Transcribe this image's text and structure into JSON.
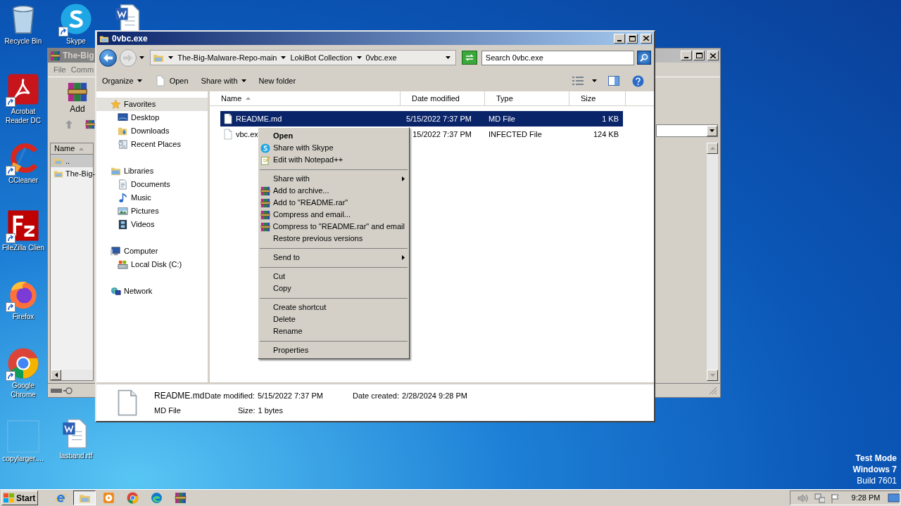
{
  "desktop_icons": [
    {
      "label": "Recycle Bin",
      "kind": "recycle",
      "shortcut": false
    },
    {
      "label": "Skype",
      "kind": "skype",
      "shortcut": true
    },
    {
      "kind": "word",
      "shortcut": false
    },
    {
      "label": "Acrobat Reader DC",
      "kind": "acrobat",
      "shortcut": true
    },
    {
      "label": "CCleaner",
      "kind": "ccleaner",
      "shortcut": true
    },
    {
      "label": "FileZilla Clien",
      "kind": "filezilla",
      "shortcut": true
    },
    {
      "label": "Firefox",
      "kind": "firefox",
      "shortcut": true
    },
    {
      "label": "Google Chrome",
      "kind": "chrome",
      "shortcut": true
    },
    {
      "label": "copylarger.…",
      "kind": "blank",
      "shortcut": false
    },
    {
      "label": "lasband.rtf",
      "kind": "word",
      "shortcut": false
    }
  ],
  "archiver_window": {
    "title": "The-Big",
    "menu": [
      "File",
      "Comm"
    ],
    "toolbar": [
      {
        "label": "Add"
      }
    ],
    "list_header": "Name",
    "rows": [
      {
        "name": "..",
        "selected": true
      },
      {
        "name": "The-Big-",
        "selected": false
      }
    ]
  },
  "explorer": {
    "title": "0vbc.exe",
    "breadcrumb": [
      "The-Big-Malware-Repo-main",
      "LokiBot Collection",
      "0vbc.exe"
    ],
    "search": {
      "placeholder": "Search 0vbc.exe"
    },
    "toolbar": [
      {
        "label": "Organize",
        "kind": "plain",
        "dropdown": true
      },
      {
        "label": "Open",
        "kind": "file",
        "dropdown": false
      },
      {
        "label": "Share with",
        "kind": "plain",
        "dropdown": true
      },
      {
        "label": "New folder",
        "kind": "plain",
        "dropdown": false
      }
    ],
    "nav": [
      {
        "label": "Favorites",
        "kind": "star",
        "selected": true,
        "children": [
          {
            "label": "Desktop",
            "kind": "desktop",
            "selected": false
          },
          {
            "label": "Downloads",
            "kind": "downloads",
            "selected": false
          },
          {
            "label": "Recent Places",
            "kind": "recent",
            "selected": false
          }
        ]
      },
      {
        "label": "Libraries",
        "kind": "libraries",
        "selected": false,
        "children": [
          {
            "label": "Documents",
            "kind": "documents",
            "selected": false
          },
          {
            "label": "Music",
            "kind": "music",
            "selected": false
          },
          {
            "label": "Pictures",
            "kind": "pictures",
            "selected": false
          },
          {
            "label": "Videos",
            "kind": "videos",
            "selected": false
          }
        ]
      },
      {
        "label": "Computer",
        "kind": "computer",
        "selected": false,
        "children": [
          {
            "label": "Local Disk (C:)",
            "kind": "disk",
            "selected": false
          }
        ]
      },
      {
        "label": "Network",
        "kind": "network",
        "selected": false
      }
    ],
    "columns": [
      {
        "label": "Name",
        "sorted": true
      },
      {
        "label": "Date modified",
        "sorted": false
      },
      {
        "label": "Type",
        "sorted": false
      },
      {
        "label": "Size",
        "sorted": false
      }
    ],
    "rows": [
      {
        "name": "README.md",
        "date": "5/15/2022 7:37 PM",
        "type": "MD File",
        "size": "1 KB",
        "selected": true
      },
      {
        "name": "vbc.ex",
        "date": "15/2022 7:37 PM",
        "type": "INFECTED File",
        "size": "124 KB",
        "selected": false
      }
    ],
    "details": {
      "name": "README.md",
      "type": "MD File",
      "fields": [
        {
          "label": "Date modified:",
          "value": "5/15/2022 7:37 PM"
        },
        {
          "label": "Size:",
          "value": "1 bytes"
        },
        {
          "label": "Date created:",
          "value": "2/28/2024 9:28 PM"
        }
      ]
    }
  },
  "context_menu": {
    "groups": [
      [
        {
          "label": "Open",
          "kind": "plain",
          "default": true,
          "submenu": false
        },
        {
          "label": "Share with Skype",
          "kind": "skype",
          "default": false,
          "submenu": false
        },
        {
          "label": "Edit with Notepad++",
          "kind": "notepad",
          "default": false,
          "submenu": false
        }
      ],
      [
        {
          "label": "Share with",
          "kind": "plain",
          "default": false,
          "submenu": true
        },
        {
          "label": "Add to archive...",
          "kind": "archive",
          "default": false,
          "submenu": false
        },
        {
          "label": "Add to \"README.rar\"",
          "kind": "archive",
          "default": false,
          "submenu": false
        },
        {
          "label": "Compress and email...",
          "kind": "archive",
          "default": false,
          "submenu": false
        },
        {
          "label": "Compress to \"README.rar\" and email",
          "kind": "archive",
          "default": false,
          "submenu": false
        },
        {
          "label": "Restore previous versions",
          "kind": "plain",
          "default": false,
          "submenu": false
        }
      ],
      [
        {
          "label": "Send to",
          "kind": "plain",
          "default": false,
          "submenu": true
        }
      ],
      [
        {
          "label": "Cut",
          "kind": "plain",
          "default": false,
          "submenu": false
        },
        {
          "label": "Copy",
          "kind": "plain",
          "default": false,
          "submenu": false
        }
      ],
      [
        {
          "label": "Create shortcut",
          "kind": "plain",
          "default": false,
          "submenu": false
        },
        {
          "label": "Delete",
          "kind": "plain",
          "default": false,
          "submenu": false
        },
        {
          "label": "Rename",
          "kind": "plain",
          "default": false,
          "submenu": false
        }
      ],
      [
        {
          "label": "Properties",
          "kind": "plain",
          "default": false,
          "submenu": false
        }
      ]
    ]
  },
  "test_mode_notice": [
    {
      "text": "Test Mode",
      "bold": true
    },
    {
      "text": "Windows 7",
      "bold": true
    },
    {
      "text": "Build 7601",
      "bold": false
    }
  ],
  "taskbar": {
    "start": "Start",
    "apps": [
      {
        "kind": "ie",
        "selected": false
      },
      {
        "kind": "explorer",
        "selected": true
      },
      {
        "kind": "media",
        "selected": false
      },
      {
        "kind": "chrome",
        "selected": false
      },
      {
        "kind": "edge",
        "selected": false
      },
      {
        "kind": "winrar",
        "selected": false
      }
    ],
    "clock": "9:28 PM"
  }
}
